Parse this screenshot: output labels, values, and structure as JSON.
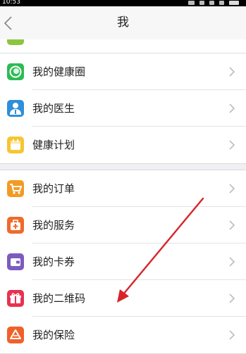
{
  "status_bar": {
    "time": "10:53"
  },
  "header": {
    "title": "我"
  },
  "sections": [
    {
      "items": [
        {
          "label": "我的健康圈",
          "icon": "circle-icon",
          "color": "#2dbb54"
        },
        {
          "label": "我的医生",
          "icon": "doctor-icon",
          "color": "#2f8fd9"
        },
        {
          "label": "健康计划",
          "icon": "calendar-icon",
          "color": "#f7c531"
        }
      ]
    },
    {
      "items": [
        {
          "label": "我的订单",
          "icon": "cart-icon",
          "color": "#f39a23"
        },
        {
          "label": "我的服务",
          "icon": "medkit-icon",
          "color": "#f06a2b"
        },
        {
          "label": "我的卡券",
          "icon": "wallet-icon",
          "color": "#7d5bbf"
        },
        {
          "label": "我的二维码",
          "icon": "gift-icon",
          "color": "#e8324f"
        },
        {
          "label": "我的保险",
          "icon": "shield-icon",
          "color": "#f0612a"
        }
      ]
    }
  ],
  "annotation": {
    "arrow_color": "#d8232a"
  }
}
